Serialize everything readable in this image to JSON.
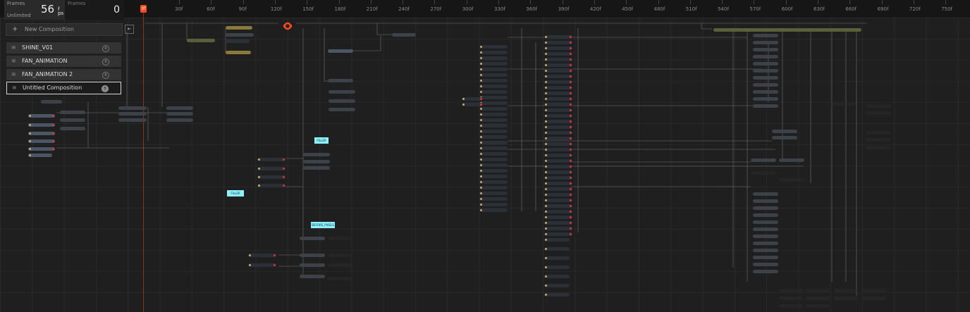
{
  "stats": {
    "fps_label": "Frames",
    "fps_value": "56",
    "fps_unit_top": "f",
    "fps_unit_bottom": "ps",
    "fps_mode": "Unlimited",
    "frames_label": "Frames",
    "frames_value": "0"
  },
  "timeline": {
    "playhead_label": "0f",
    "ticks": [
      "30f",
      "60f",
      "90f",
      "120f",
      "150f",
      "180f",
      "210f",
      "240f",
      "270f",
      "300f",
      "330f",
      "360f",
      "390f",
      "420f",
      "450f",
      "480f",
      "510f",
      "540f",
      "570f",
      "600f",
      "630f",
      "660f",
      "690f",
      "720f",
      "750f"
    ]
  },
  "compositions": {
    "new_label": "New Composition",
    "collapse_icon": "collapse-icon",
    "items": [
      {
        "name": "SHINE_V01",
        "count": "0"
      },
      {
        "name": "FAN_ANIMATION",
        "count": "0"
      },
      {
        "name": "FAN_ANIMATION 2",
        "count": "0"
      },
      {
        "name": "Untitled Composition",
        "count": "5"
      }
    ]
  },
  "colors": {
    "accent": "#ff4a1c",
    "label_box": "#8ff0ff",
    "active_border": "#d8d8d8"
  },
  "canvas_labels": {
    "label_1": "FILLER",
    "label_2": "FILLER",
    "label_3": "BEFORE_PIXELS"
  }
}
